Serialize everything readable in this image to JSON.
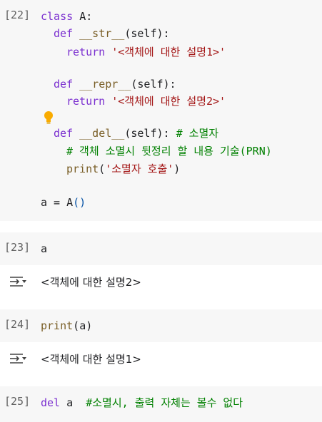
{
  "cells": [
    {
      "count": "[22]",
      "lines": [
        {
          "indent": 0,
          "tokens": [
            {
              "t": "kw",
              "v": "class "
            },
            {
              "t": "plain",
              "v": "A:"
            }
          ]
        },
        {
          "indent": 1,
          "tokens": [
            {
              "t": "kw",
              "v": "def "
            },
            {
              "t": "fn",
              "v": "__str__"
            },
            {
              "t": "paren",
              "v": "("
            },
            {
              "t": "plain",
              "v": "self"
            },
            {
              "t": "paren",
              "v": "):"
            }
          ]
        },
        {
          "indent": 2,
          "tokens": [
            {
              "t": "kw",
              "v": "return "
            },
            {
              "t": "str",
              "v": "'<객체에 대한 설명1>'"
            }
          ]
        },
        {
          "indent": 1,
          "tokens": [
            {
              "t": "kw",
              "v": "def "
            },
            {
              "t": "fn",
              "v": "__repr__"
            },
            {
              "t": "paren",
              "v": "("
            },
            {
              "t": "plain",
              "v": "self"
            },
            {
              "t": "paren",
              "v": "):"
            }
          ]
        },
        {
          "indent": 2,
          "tokens": [
            {
              "t": "kw",
              "v": "return "
            },
            {
              "t": "str",
              "v": "'<객체에 대한 설명2>'"
            }
          ]
        },
        {
          "indent": 1,
          "tokens": [
            {
              "t": "kw",
              "v": "def "
            },
            {
              "t": "fn",
              "v": "__del__"
            },
            {
              "t": "paren",
              "v": "("
            },
            {
              "t": "plain",
              "v": "self"
            },
            {
              "t": "paren",
              "v": "): "
            },
            {
              "t": "cm",
              "v": "# 소멸자"
            }
          ]
        },
        {
          "indent": 2,
          "tokens": [
            {
              "t": "cm",
              "v": "# 객체 소멸시 뒷정리 할 내용 기술(PRN)"
            }
          ]
        },
        {
          "indent": 2,
          "tokens": [
            {
              "t": "fn",
              "v": "print"
            },
            {
              "t": "paren",
              "v": "("
            },
            {
              "t": "str",
              "v": "'소멸자 호출'"
            },
            {
              "t": "paren",
              "v": ")"
            }
          ]
        },
        {
          "indent": 0,
          "tokens": [
            {
              "t": "plain",
              "v": "a = A"
            },
            {
              "t": "paren2",
              "v": "()"
            }
          ]
        }
      ]
    },
    {
      "count": "[23]",
      "lines": [
        {
          "indent": 0,
          "tokens": [
            {
              "t": "plain",
              "v": "a"
            }
          ]
        }
      ],
      "output": "<객체에 대한 설명2>"
    },
    {
      "count": "[24]",
      "lines": [
        {
          "indent": 0,
          "tokens": [
            {
              "t": "fn",
              "v": "print"
            },
            {
              "t": "paren",
              "v": "("
            },
            {
              "t": "plain",
              "v": "a"
            },
            {
              "t": "paren",
              "v": ")"
            }
          ]
        }
      ],
      "output": "<객체에 대한 설명1>"
    },
    {
      "count": "[25]",
      "lines": [
        {
          "indent": 0,
          "tokens": [
            {
              "t": "kw",
              "v": "del "
            },
            {
              "t": "plain",
              "v": "a  "
            },
            {
              "t": "cm",
              "v": "#소멸시, 출력 자체는 볼수 없다"
            }
          ]
        }
      ]
    }
  ],
  "icons": {
    "lightbulb": "lightbulb-icon",
    "output_toggle": "output-toggle-icon"
  },
  "colors": {
    "keyword": "#7b30d0",
    "function": "#795e26",
    "string": "#a31515",
    "comment": "#008000",
    "cell_bg": "#f7f7f7"
  }
}
